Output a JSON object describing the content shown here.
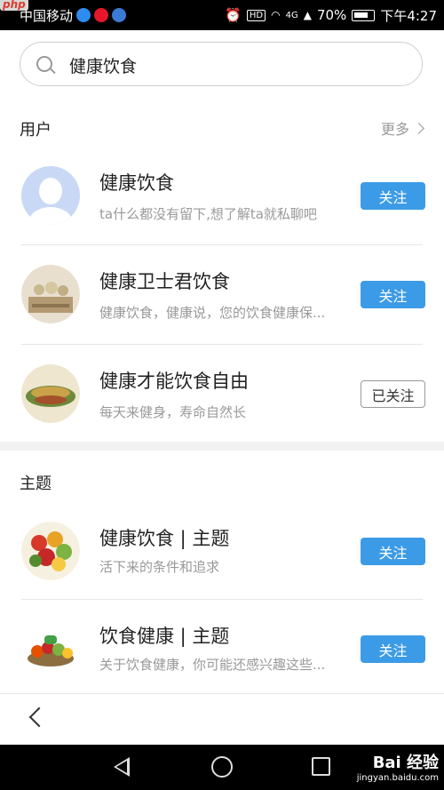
{
  "status_bar": {
    "php_badge": "php",
    "carrier": "中国移动",
    "hd": "HD",
    "signal": "4G",
    "battery": "70%",
    "time": "下午4:27"
  },
  "search": {
    "value": "健康饮食"
  },
  "users_section": {
    "title": "用户",
    "more_label": "更多",
    "items": [
      {
        "name": "健康饮食",
        "desc": "ta什么都没有留下,想了解ta就私聊吧",
        "button": "关注",
        "followed": false
      },
      {
        "name": "健康卫士君饮食",
        "desc": "健康饮食，健康说，您的饮食健康保...",
        "button": "关注",
        "followed": false
      },
      {
        "name": "健康才能饮食自由",
        "desc": "每天来健身，寿命自然长",
        "button": "已关注",
        "followed": true
      }
    ]
  },
  "topics_section": {
    "title": "主题",
    "items": [
      {
        "name": "健康饮食 | 主题",
        "desc": "活下来的条件和追求",
        "button": "关注"
      },
      {
        "name": "饮食健康 | 主题",
        "desc": "关于饮食健康，你可能还感兴趣这些...",
        "button": "关注"
      }
    ]
  },
  "watermark": {
    "brand": "Bai 经验",
    "url": "jingyan.baidu.com"
  },
  "colors": {
    "accent": "#3c9be6",
    "muted": "#999999",
    "text": "#222222"
  }
}
